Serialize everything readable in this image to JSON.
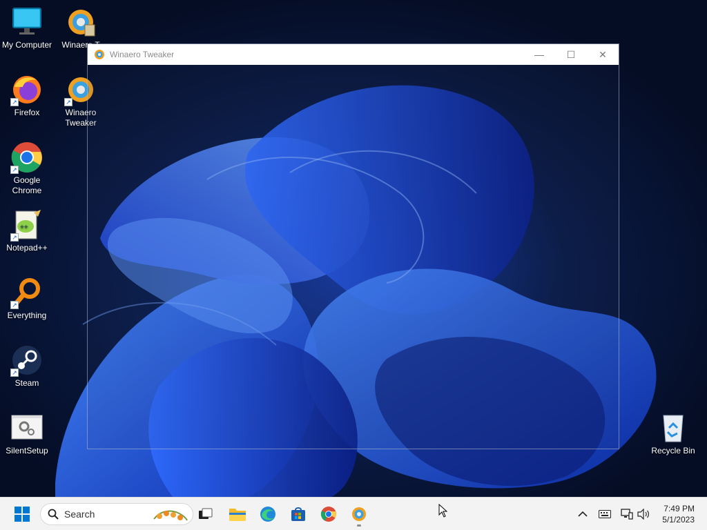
{
  "desktop": {
    "icons": [
      {
        "label": "My Computer",
        "icon": "monitor-icon"
      },
      {
        "label": "Winaero T",
        "icon": "winaero-tweaker-icon"
      },
      {
        "label": "Firefox",
        "icon": "firefox-icon"
      },
      {
        "label": "Winaero Tweaker",
        "icon": "winaero-tweaker-icon"
      },
      {
        "label": "Google Chrome",
        "icon": "chrome-icon"
      },
      {
        "label": "Notepad++",
        "icon": "notepad-plus-plus-icon"
      },
      {
        "label": "Everything",
        "icon": "everything-search-icon"
      },
      {
        "label": "Steam",
        "icon": "steam-icon"
      },
      {
        "label": "SilentSetup",
        "icon": "silentsetup-icon"
      },
      {
        "label": "Recycle Bin",
        "icon": "recycle-bin-icon"
      }
    ]
  },
  "window": {
    "title": "Winaero Tweaker",
    "minimize_label": "—",
    "maximize_label": "☐",
    "close_label": "✕"
  },
  "taskbar": {
    "search_label": "Search",
    "apps": [
      "start-icon",
      "search-icon",
      "task-view-icon",
      "file-explorer-icon",
      "edge-icon",
      "microsoft-store-icon",
      "chrome-icon",
      "winaero-tweaker-icon"
    ],
    "tray": [
      "chevron-up-icon",
      "keyboard-icon",
      "network-icon",
      "volume-icon"
    ],
    "time": "7:49 PM",
    "date": "5/1/2023"
  },
  "colors": {
    "taskbar_bg": "#f3f3f3",
    "wallpaper_accent": "#1e5bff",
    "wallpaper_dark": "#0a1a44"
  }
}
